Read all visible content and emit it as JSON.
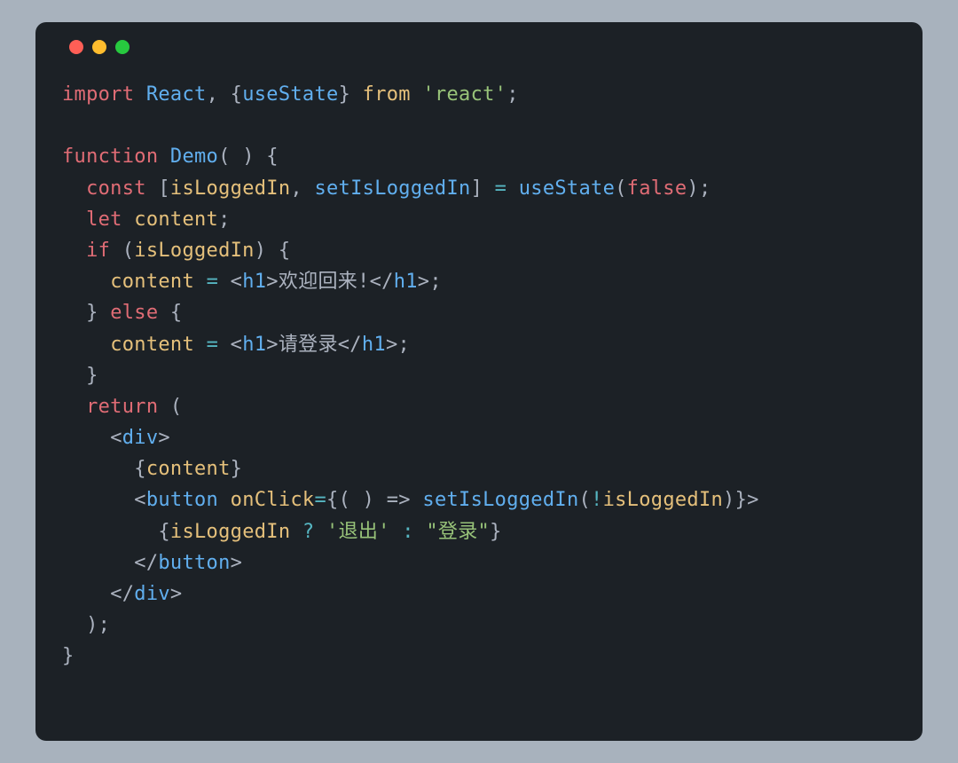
{
  "code": {
    "line1": {
      "import": "import",
      "React": "React",
      "lbrace": "{",
      "useState": "useState",
      "rbrace": "}",
      "from": "from",
      "reactStr": "'react'",
      "semi": ";"
    },
    "line2": "",
    "line3": {
      "function": "function",
      "Demo": "Demo",
      "parens": "( )",
      "lbrace": "{"
    },
    "line4": {
      "const": "const",
      "lbracket": "[",
      "isLoggedIn": "isLoggedIn",
      "comma": ",",
      "setIsLoggedIn": "setIsLoggedIn",
      "rbracket": "]",
      "eq": "=",
      "useState": "useState",
      "lparen": "(",
      "false": "false",
      "rparen_semi": ");"
    },
    "line5": {
      "let": "let",
      "content": "content",
      "semi": ";"
    },
    "line6": {
      "if": "if",
      "lparen": "(",
      "isLoggedIn": "isLoggedIn",
      "rparen": ")",
      "lbrace": "{"
    },
    "line7": {
      "content": "content",
      "eq": "=",
      "openTag": "<",
      "h1a": "h1",
      "gt1": ">",
      "text": "欢迎回来!",
      "closeOpen": "</",
      "h1b": "h1",
      "gt2": ">",
      "semi": ";"
    },
    "line8": {
      "rbrace": "}",
      "else": "else",
      "lbrace": "{"
    },
    "line9": {
      "content": "content",
      "eq": "=",
      "openTag": "<",
      "h1a": "h1",
      "gt1": ">",
      "text": "请登录",
      "closeOpen": "</",
      "h1b": "h1",
      "gt2": ">",
      "semi": ";"
    },
    "line10": {
      "rbrace": "}"
    },
    "line11": {
      "return": "return",
      "lparen": "("
    },
    "line12": {
      "lt": "<",
      "div": "div",
      "gt": ">"
    },
    "line13": {
      "lbrace": "{",
      "content": "content",
      "rbrace": "}"
    },
    "line14": {
      "lt": "<",
      "button": "button",
      "onClick": "onClick",
      "eq1": "=",
      "lbrace": "{",
      "arrow": "( ) =>",
      "setIsLoggedIn": "setIsLoggedIn",
      "lparen": "(",
      "bang": "!",
      "isLoggedIn": "isLoggedIn",
      "rparen": ")",
      "rbrace": "}",
      "gt": ">"
    },
    "line15": {
      "lbrace": "{",
      "isLoggedIn": "isLoggedIn",
      "q": "?",
      "str1": "'退出'",
      "colon": ":",
      "str2": "\"登录\"",
      "rbrace": "}"
    },
    "line16": {
      "lt": "</",
      "button": "button",
      "gt": ">"
    },
    "line17": {
      "lt": "</",
      "div": "div",
      "gt": ">"
    },
    "line18": {
      "rparen_semi": ");"
    },
    "line19": {
      "rbrace": "}"
    }
  }
}
